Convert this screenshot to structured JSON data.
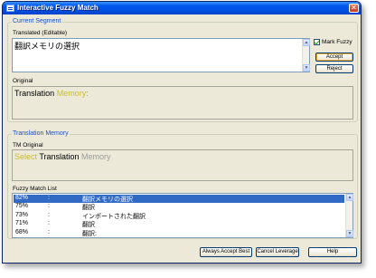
{
  "window": {
    "title": "Interactive Fuzzy Match",
    "close_glyph": "✕"
  },
  "current_segment": {
    "group_label": "Current Segment",
    "translated_label": "Translated (Editable)",
    "translated_value": "翻訳メモリの選択",
    "mark_fuzzy_label": "Mark Fuzzy",
    "mark_fuzzy_checked": true,
    "accept_label": "Accept",
    "reject_label": "Reject",
    "original_label": "Original",
    "original_tokens": [
      {
        "text": "Translation ",
        "color": "black"
      },
      {
        "text": "Memory",
        "color": "yellow"
      },
      {
        "text": ":",
        "color": "grey"
      }
    ]
  },
  "translation_memory": {
    "group_label": "Translation Memory",
    "tm_original_label": "TM Original",
    "tm_original_tokens": [
      {
        "text": "Select ",
        "color": "yellow"
      },
      {
        "text": "Translation ",
        "color": "black"
      },
      {
        "text": "Memory",
        "color": "grey"
      }
    ],
    "fuzzy_list_label": "Fuzzy Match List",
    "matches": [
      {
        "pct": "82%",
        "sep": ":",
        "text": "翻訳メモリの選択",
        "selected": true
      },
      {
        "pct": "75%",
        "sep": ":",
        "text": "翻訳",
        "selected": false
      },
      {
        "pct": "73%",
        "sep": ":",
        "text": "インポートされた翻訳",
        "selected": false
      },
      {
        "pct": "71%",
        "sep": ":",
        "text": "翻訳",
        "selected": false
      },
      {
        "pct": "68%",
        "sep": ":",
        "text": "翻訳:",
        "selected": false
      }
    ]
  },
  "footer": {
    "always_accept_best_label": "Always Accept Best",
    "cancel_leverage_label": "Cancel Leverage",
    "help_label": "Help"
  },
  "colors": {
    "selection": "#316ac5",
    "group_label": "#1c4fc4",
    "yellow_token": "#c9bd2e",
    "grey_token": "#9c9c9c"
  }
}
